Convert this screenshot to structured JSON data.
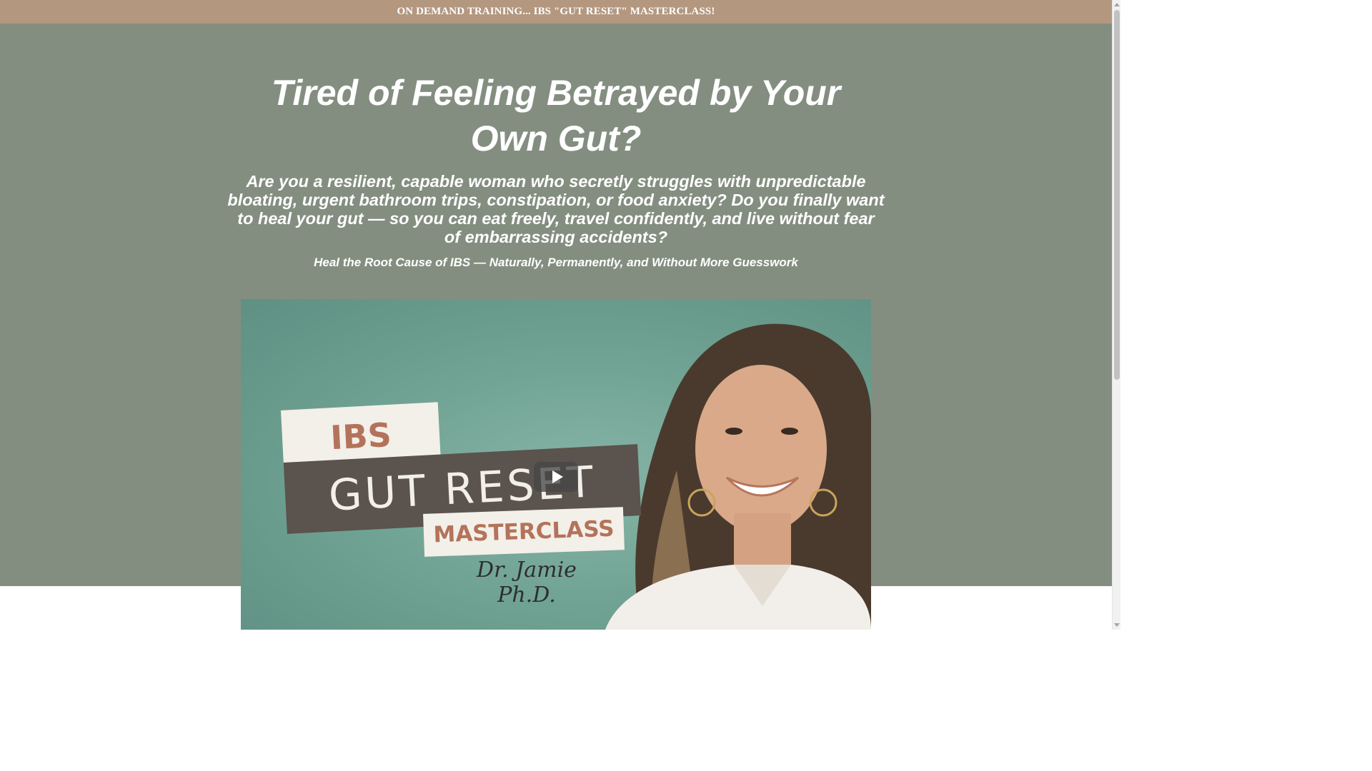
{
  "announcement_bar": {
    "text": "ON DEMAND TRAINING... IBS \"GUT RESET\" MASTERCLASS!"
  },
  "hero": {
    "headline": "Tired of Feeling Betrayed by Your Own Gut?",
    "subheadline": "Are you a resilient, capable woman who secretly struggles with unpredictable bloating, urgent bathroom trips, constipation, or food anxiety? Do you finally want to heal your gut — so you can eat freely, travel confidently, and live without fear of embarrassing accidents?",
    "tagline": "Heal the Root Cause of IBS — Naturally, Permanently, and Without More Guesswork"
  },
  "video": {
    "thumbnail": {
      "card_1": "IBS",
      "card_2": "GUT RESET",
      "card_3": "MASTERCLASS",
      "signature": "Dr. Jamie Ph.D."
    },
    "play_icon": "play-icon"
  },
  "colors": {
    "announcement_bg": "#b3977f",
    "hero_bg": "#838e80",
    "video_bg": "#6fa293"
  }
}
